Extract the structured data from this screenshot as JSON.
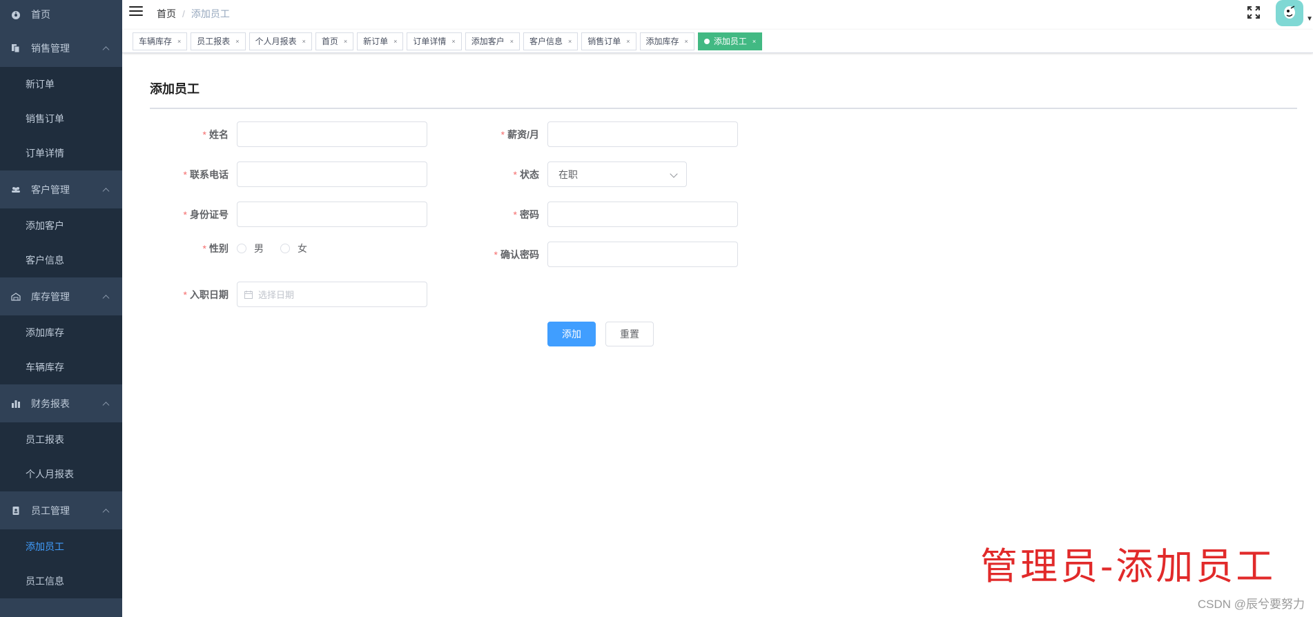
{
  "sidebar": {
    "home": "首页",
    "groups": [
      {
        "title": "销售管理",
        "items": [
          "新订单",
          "销售订单",
          "订单详情"
        ]
      },
      {
        "title": "客户管理",
        "items": [
          "添加客户",
          "客户信息"
        ]
      },
      {
        "title": "库存管理",
        "items": [
          "添加库存",
          "车辆库存"
        ]
      },
      {
        "title": "财务报表",
        "items": [
          "员工报表",
          "个人月报表"
        ]
      },
      {
        "title": "员工管理",
        "items": [
          "添加员工",
          "员工信息"
        ]
      }
    ]
  },
  "navbar": {
    "breadcrumb_home": "首页",
    "breadcrumb_sep": "/",
    "breadcrumb_current": "添加员工"
  },
  "tags": [
    "车辆库存",
    "员工报表",
    "个人月报表",
    "首页",
    "新订单",
    "订单详情",
    "添加客户",
    "客户信息",
    "销售订单",
    "添加库存",
    "添加员工"
  ],
  "tag_close": "×",
  "page": {
    "title": "添加员工",
    "required_mark": "*",
    "fields": {
      "name_label": "姓名",
      "phone_label": "联系电话",
      "id_label": "身份证号",
      "gender_label": "性别",
      "gender_male": "男",
      "gender_female": "女",
      "hire_date_label": "入职日期",
      "hire_date_placeholder": "选择日期",
      "salary_label": "薪资/月",
      "status_label": "状态",
      "status_value": "在职",
      "password_label": "密码",
      "confirm_password_label": "确认密码"
    },
    "add_button": "添加",
    "reset_button": "重置"
  },
  "watermark": "管理员-添加员工",
  "csdn_credit": "CSDN @辰兮要努力",
  "colors": {
    "sidebar_bg": "#304156",
    "submenu_bg": "#1f2d3d",
    "active_tag": "#42b983",
    "primary": "#409eff",
    "required": "#f56c6c",
    "watermark": "#e12a2a"
  }
}
